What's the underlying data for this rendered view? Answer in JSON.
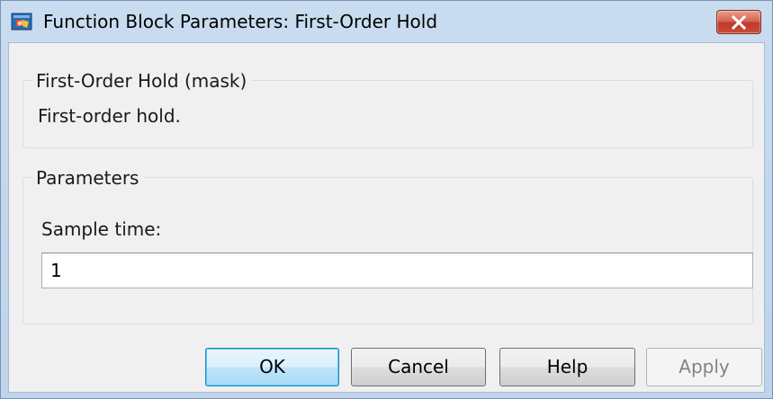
{
  "window": {
    "title": "Function Block Parameters: First-Order Hold"
  },
  "mask_group": {
    "legend": "First-Order Hold (mask)",
    "description": "First-order hold."
  },
  "parameters_group": {
    "legend": "Parameters",
    "sample_time_label": "Sample time:",
    "sample_time_value": "1"
  },
  "buttons": {
    "ok": "OK",
    "cancel": "Cancel",
    "help": "Help",
    "apply": "Apply"
  },
  "colors": {
    "close_button": "#c94e36",
    "title_bar": "#c9dcf0",
    "client_background": "#f0f0f0",
    "default_button_border": "#3c7fb1",
    "disabled_text": "#838383"
  },
  "icons": {
    "app": "simulink-block-icon",
    "close": "close-icon"
  }
}
